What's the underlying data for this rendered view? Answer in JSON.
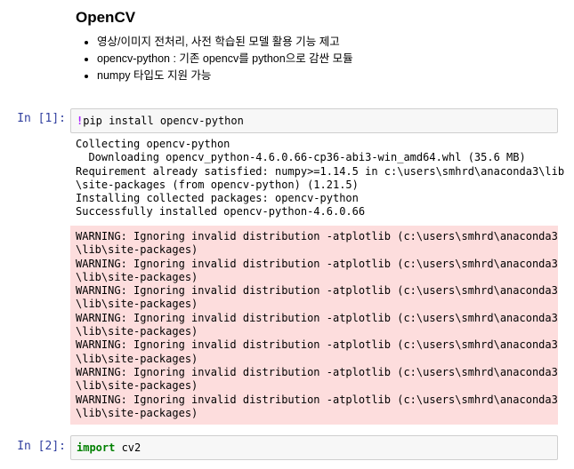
{
  "markdown": {
    "title": "OpenCV",
    "bullets": [
      "영상/이미지 전처리, 사전 학습된 모델 활용 기능 제고",
      "opencv-python : 기존 opencv를 python으로 감싼 모듈",
      "numpy 타입도 지원 가능"
    ]
  },
  "cells": [
    {
      "prompt": "In [1]:",
      "code_prefix": "!",
      "code_rest": "pip install opencv-python",
      "stdout": [
        "Collecting opencv-python",
        "  Downloading opencv_python-4.6.0.66-cp36-abi3-win_amd64.whl (35.6 MB)",
        "Requirement already satisfied: numpy>=1.14.5 in c:\\users\\smhrd\\anaconda3\\lib",
        "\\site-packages (from opencv-python) (1.21.5)",
        "Installing collected packages: opencv-python",
        "Successfully installed opencv-python-4.6.0.66"
      ],
      "stderr": [
        "WARNING: Ignoring invalid distribution -atplotlib (c:\\users\\smhrd\\anaconda3",
        "\\lib\\site-packages)",
        "WARNING: Ignoring invalid distribution -atplotlib (c:\\users\\smhrd\\anaconda3",
        "\\lib\\site-packages)",
        "WARNING: Ignoring invalid distribution -atplotlib (c:\\users\\smhrd\\anaconda3",
        "\\lib\\site-packages)",
        "WARNING: Ignoring invalid distribution -atplotlib (c:\\users\\smhrd\\anaconda3",
        "\\lib\\site-packages)",
        "WARNING: Ignoring invalid distribution -atplotlib (c:\\users\\smhrd\\anaconda3",
        "\\lib\\site-packages)",
        "WARNING: Ignoring invalid distribution -atplotlib (c:\\users\\smhrd\\anaconda3",
        "\\lib\\site-packages)",
        "WARNING: Ignoring invalid distribution -atplotlib (c:\\users\\smhrd\\anaconda3",
        "\\lib\\site-packages)"
      ]
    },
    {
      "prompt": "In [2]:",
      "code_keyword": "import",
      "code_rest": " cv2"
    }
  ],
  "colors": {
    "prompt": "#303f9f",
    "stderr_bg": "#fddddd",
    "input_bg": "#f7f7f7",
    "magic": "#aa22ff",
    "keyword": "#008000"
  }
}
